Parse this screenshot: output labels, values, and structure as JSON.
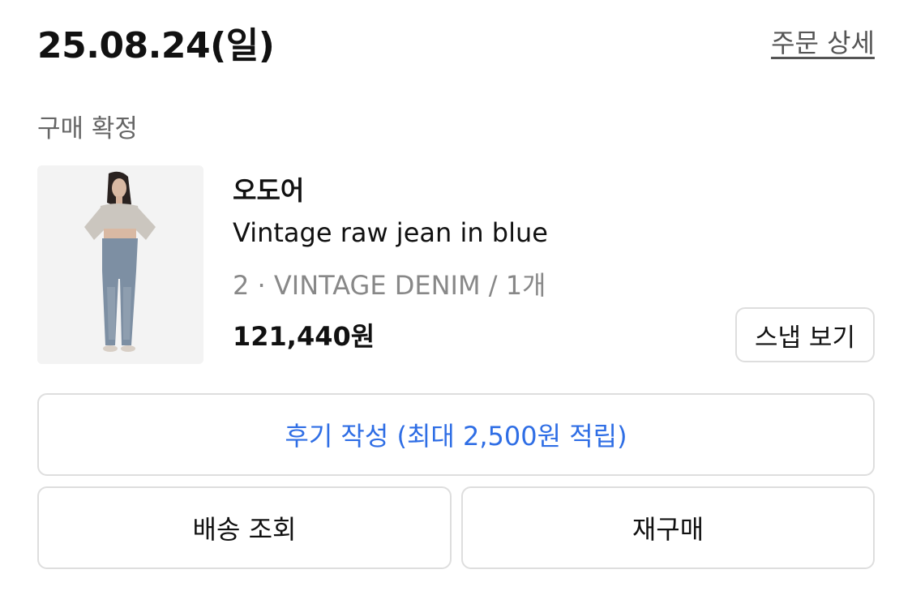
{
  "order": {
    "date": "25.08.24(일)",
    "detail_link": "주문 상세",
    "status": "구매 확정"
  },
  "product": {
    "image_icon": "product-photo-model-in-jeans",
    "brand": "오도어",
    "name": "Vintage raw jean in blue",
    "option": "2 · VINTAGE DENIM / 1개",
    "price": "121,440원",
    "snap_button": "스냅 보기"
  },
  "actions": {
    "review": "후기 작성 (최대 2,500원 적립)",
    "track": "배송 조회",
    "rebuy": "재구매"
  },
  "colors": {
    "accent_blue": "#2f6ee5",
    "border": "#dedede",
    "muted_text": "#888888"
  }
}
